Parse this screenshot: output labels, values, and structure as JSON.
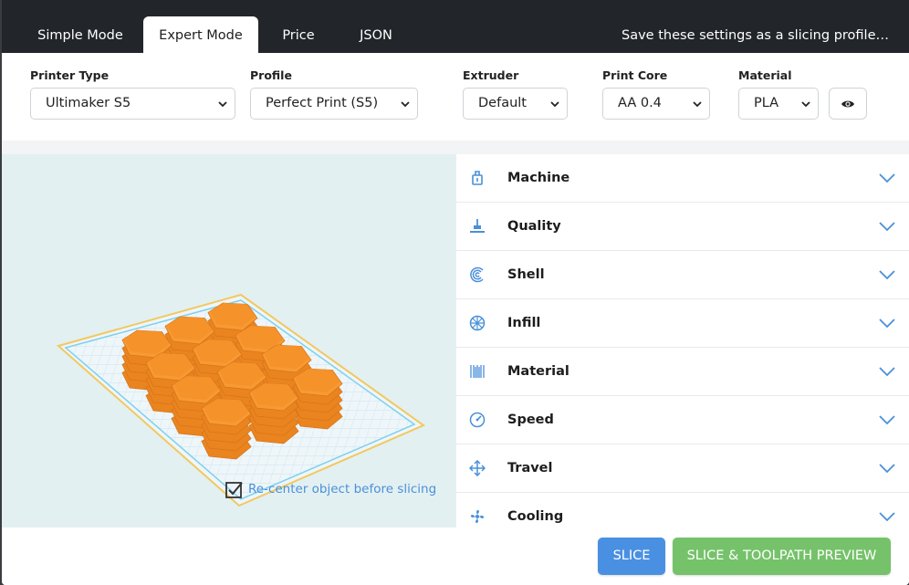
{
  "tabs": [
    {
      "label": "Simple Mode",
      "active": false
    },
    {
      "label": "Expert Mode",
      "active": true
    },
    {
      "label": "Price",
      "active": false
    },
    {
      "label": "JSON",
      "active": false
    }
  ],
  "save_link": "Save these settings as a slicing profile…",
  "fields": {
    "printer_type": {
      "label": "Printer Type",
      "value": "Ultimaker S5"
    },
    "profile": {
      "label": "Profile",
      "value": "Perfect Print (S5)"
    },
    "extruder": {
      "label": "Extruder",
      "value": "Default"
    },
    "print_core": {
      "label": "Print Core",
      "value": "AA 0.4"
    },
    "material": {
      "label": "Material",
      "value": "PLA"
    }
  },
  "recenter": {
    "label": "Re-center object before slicing",
    "checked": true
  },
  "sections": [
    {
      "label": "Machine",
      "icon": "printer-icon"
    },
    {
      "label": "Quality",
      "icon": "quality-icon"
    },
    {
      "label": "Shell",
      "icon": "shell-icon"
    },
    {
      "label": "Infill",
      "icon": "infill-icon"
    },
    {
      "label": "Material",
      "icon": "material-icon"
    },
    {
      "label": "Speed",
      "icon": "speed-icon"
    },
    {
      "label": "Travel",
      "icon": "travel-icon"
    },
    {
      "label": "Cooling",
      "icon": "cooling-icon"
    }
  ],
  "buttons": {
    "slice": "SLICE",
    "preview": "SLICE & TOOLPATH PREVIEW"
  },
  "colors": {
    "accent_blue": "#4a90e2",
    "accent_green": "#75c26a",
    "model_orange": "#f5922a",
    "topbar": "#222529"
  }
}
